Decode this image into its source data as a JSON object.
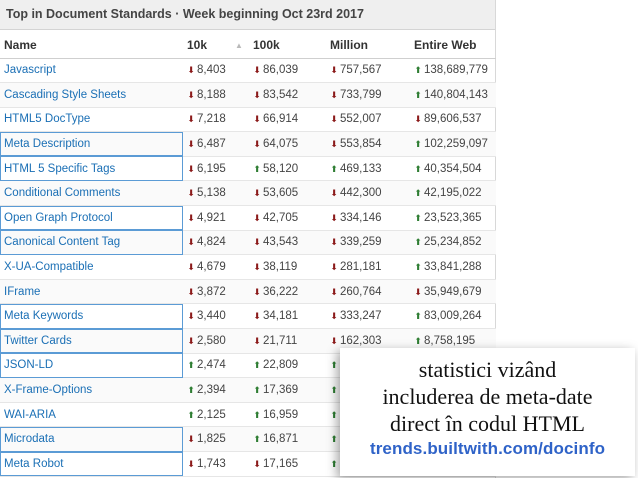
{
  "header": {
    "title": "Top in Document Standards · Week beginning Oct 23rd 2017"
  },
  "columns": [
    "Name",
    "10k",
    "100k",
    "Million",
    "Entire Web"
  ],
  "rows": [
    {
      "name": "Javascript",
      "boxed": false,
      "cells": [
        {
          "t": "down",
          "v": "8,403"
        },
        {
          "t": "down",
          "v": "86,039"
        },
        {
          "t": "down",
          "v": "757,567"
        },
        {
          "t": "up",
          "v": "138,689,779"
        }
      ]
    },
    {
      "name": "Cascading Style Sheets",
      "boxed": false,
      "cells": [
        {
          "t": "down",
          "v": "8,188"
        },
        {
          "t": "down",
          "v": "83,542"
        },
        {
          "t": "down",
          "v": "733,799"
        },
        {
          "t": "up",
          "v": "140,804,143"
        }
      ]
    },
    {
      "name": "HTML5 DocType",
      "boxed": false,
      "cells": [
        {
          "t": "down",
          "v": "7,218"
        },
        {
          "t": "down",
          "v": "66,914"
        },
        {
          "t": "down",
          "v": "552,007"
        },
        {
          "t": "down",
          "v": "89,606,537"
        }
      ]
    },
    {
      "name": "Meta Description",
      "boxed": true,
      "cells": [
        {
          "t": "down",
          "v": "6,487"
        },
        {
          "t": "down",
          "v": "64,075"
        },
        {
          "t": "down",
          "v": "553,854"
        },
        {
          "t": "up",
          "v": "102,259,097"
        }
      ]
    },
    {
      "name": "HTML 5 Specific Tags",
      "boxed": true,
      "cells": [
        {
          "t": "down",
          "v": "6,195"
        },
        {
          "t": "up",
          "v": "58,120"
        },
        {
          "t": "up",
          "v": "469,133"
        },
        {
          "t": "up",
          "v": "40,354,504"
        }
      ]
    },
    {
      "name": "Conditional Comments",
      "boxed": false,
      "cells": [
        {
          "t": "down",
          "v": "5,138"
        },
        {
          "t": "down",
          "v": "53,605"
        },
        {
          "t": "down",
          "v": "442,300"
        },
        {
          "t": "up",
          "v": "42,195,022"
        }
      ]
    },
    {
      "name": "Open Graph Protocol",
      "boxed": true,
      "cells": [
        {
          "t": "down",
          "v": "4,921"
        },
        {
          "t": "down",
          "v": "42,705"
        },
        {
          "t": "down",
          "v": "334,146"
        },
        {
          "t": "up",
          "v": "23,523,365"
        }
      ]
    },
    {
      "name": "Canonical Content Tag",
      "boxed": true,
      "cells": [
        {
          "t": "down",
          "v": "4,824"
        },
        {
          "t": "down",
          "v": "43,543"
        },
        {
          "t": "down",
          "v": "339,259"
        },
        {
          "t": "up",
          "v": "25,234,852"
        }
      ]
    },
    {
      "name": "X-UA-Compatible",
      "boxed": false,
      "cells": [
        {
          "t": "down",
          "v": "4,679"
        },
        {
          "t": "down",
          "v": "38,119"
        },
        {
          "t": "down",
          "v": "281,181"
        },
        {
          "t": "up",
          "v": "33,841,288"
        }
      ]
    },
    {
      "name": "IFrame",
      "boxed": false,
      "cells": [
        {
          "t": "down",
          "v": "3,872"
        },
        {
          "t": "down",
          "v": "36,222"
        },
        {
          "t": "down",
          "v": "260,764"
        },
        {
          "t": "down",
          "v": "35,949,679"
        }
      ]
    },
    {
      "name": "Meta Keywords",
      "boxed": true,
      "cells": [
        {
          "t": "down",
          "v": "3,440"
        },
        {
          "t": "down",
          "v": "34,181"
        },
        {
          "t": "down",
          "v": "333,247"
        },
        {
          "t": "up",
          "v": "83,009,264"
        }
      ]
    },
    {
      "name": "Twitter Cards",
      "boxed": true,
      "cells": [
        {
          "t": "down",
          "v": "2,580"
        },
        {
          "t": "down",
          "v": "21,711"
        },
        {
          "t": "down",
          "v": "162,303"
        },
        {
          "t": "up",
          "v": "8,758,195"
        }
      ]
    },
    {
      "name": "JSON-LD",
      "boxed": true,
      "cells": [
        {
          "t": "up",
          "v": "2,474"
        },
        {
          "t": "up",
          "v": "22,809"
        },
        {
          "t": "up",
          "v": ""
        },
        {
          "t": "",
          "v": ""
        }
      ]
    },
    {
      "name": "X-Frame-Options",
      "boxed": false,
      "cells": [
        {
          "t": "up",
          "v": "2,394"
        },
        {
          "t": "up",
          "v": "17,369"
        },
        {
          "t": "up",
          "v": ""
        },
        {
          "t": "",
          "v": ""
        }
      ]
    },
    {
      "name": "WAI-ARIA",
      "boxed": false,
      "cells": [
        {
          "t": "up",
          "v": "2,125"
        },
        {
          "t": "up",
          "v": "16,959"
        },
        {
          "t": "up",
          "v": ""
        },
        {
          "t": "",
          "v": ""
        }
      ]
    },
    {
      "name": "Microdata",
      "boxed": true,
      "cells": [
        {
          "t": "down",
          "v": "1,825"
        },
        {
          "t": "up",
          "v": "16,871"
        },
        {
          "t": "up",
          "v": ""
        },
        {
          "t": "",
          "v": ""
        }
      ]
    },
    {
      "name": "Meta Robot",
      "boxed": true,
      "cells": [
        {
          "t": "down",
          "v": "1,743"
        },
        {
          "t": "down",
          "v": "17,165"
        },
        {
          "t": "up",
          "v": ""
        },
        {
          "t": "",
          "v": ""
        }
      ]
    }
  ],
  "overlay": {
    "lines": [
      "statistici vizând",
      "includerea de meta-date",
      "direct în codul HTML"
    ],
    "url": "trends.builtwith.com/docinfo"
  },
  "colors": {
    "link": "#1a6fb5",
    "down": "#8b1a1a",
    "up": "#2e7d32",
    "url": "#2f63c8",
    "box": "#5b9bd5"
  },
  "icons": {
    "down": "arrow-down-icon",
    "up": "arrow-up-icon",
    "sort": "sort-up-icon"
  }
}
